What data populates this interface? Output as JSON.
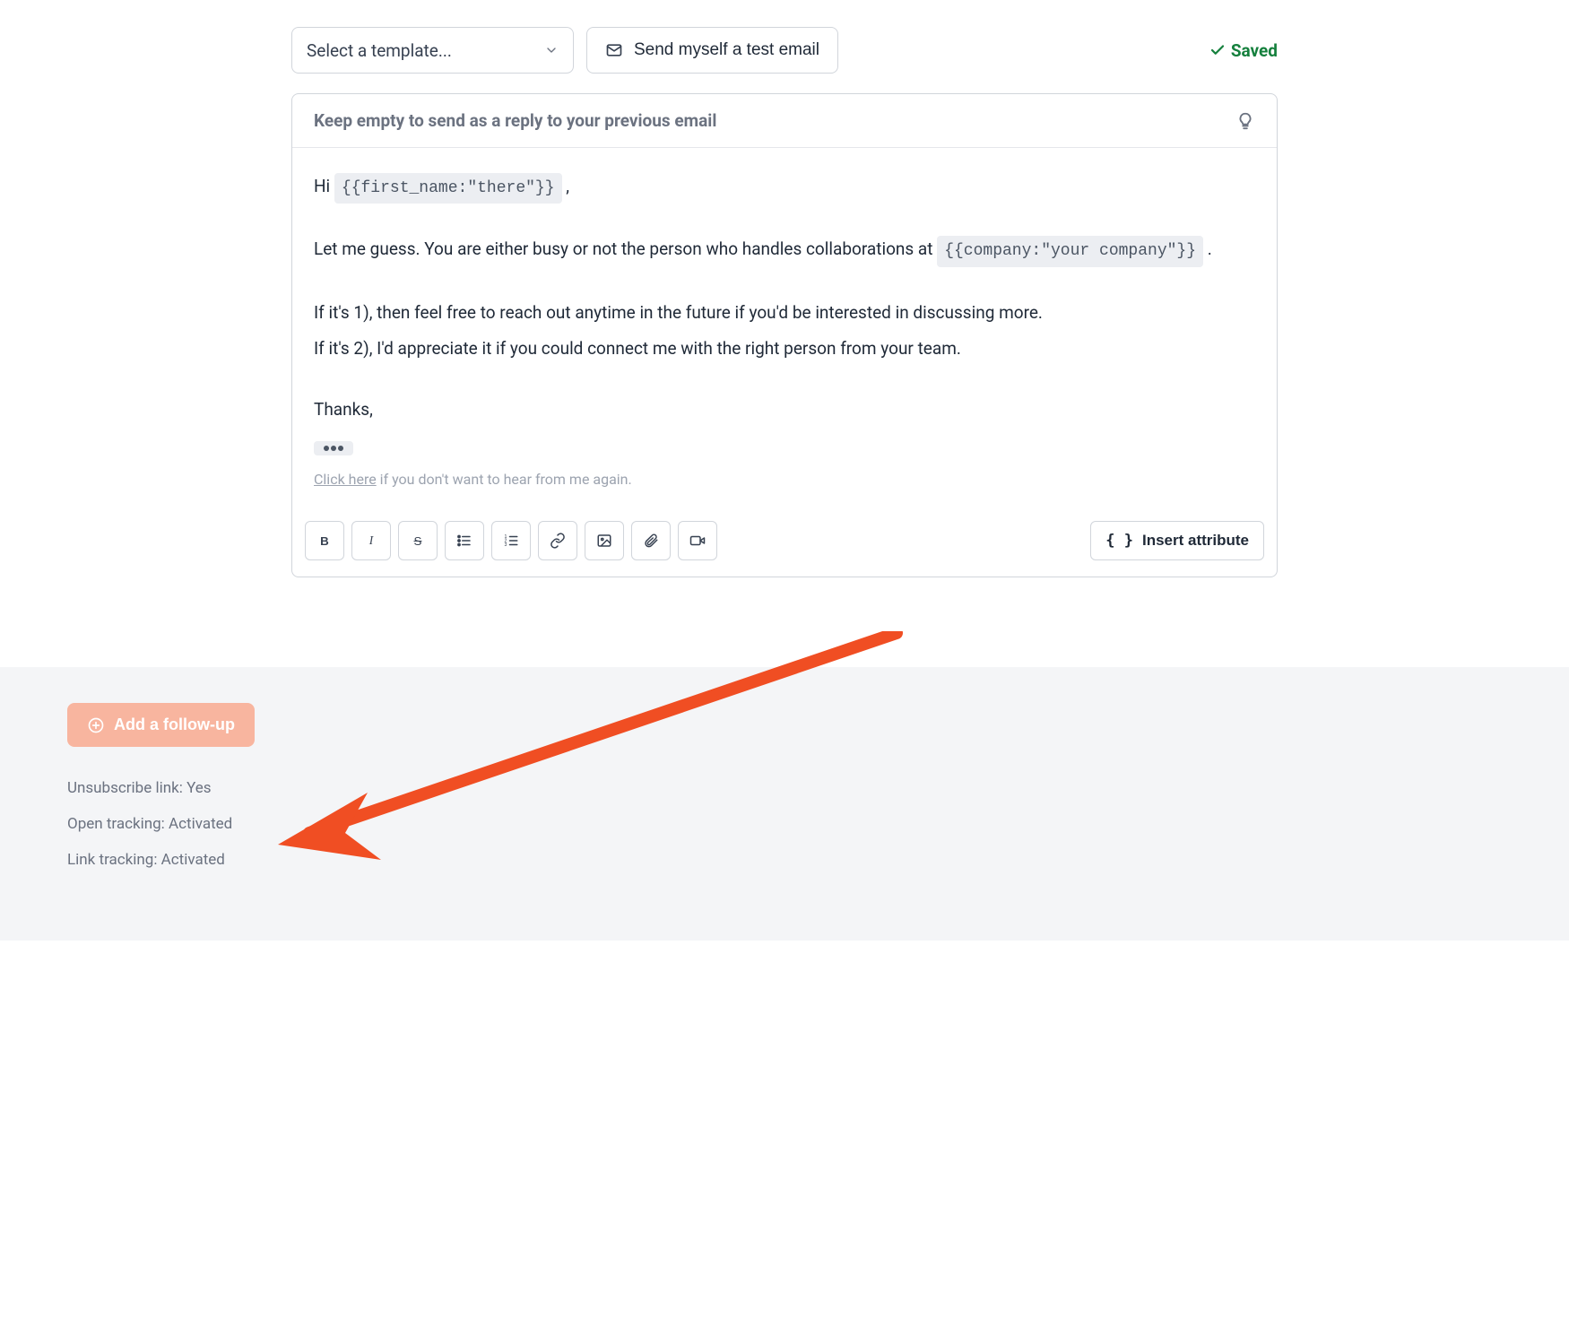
{
  "toolbar": {
    "select_template_placeholder": "Select a template...",
    "send_test_label": "Send myself a test email",
    "saved_label": "Saved"
  },
  "subject": {
    "placeholder": "Keep empty to send as a reply to your previous email"
  },
  "body": {
    "greeting_prefix": "Hi ",
    "greeting_tag": "{{first_name:\"there\"}}",
    "greeting_suffix": " ,",
    "p1_prefix": "Let me guess. You are either busy or not the person who handles collaborations at ",
    "p1_tag": "{{company:\"your company\"}}",
    "p1_suffix": " .",
    "p2": "If it's 1), then feel free to reach out anytime in the future if you'd be interested in discussing more.",
    "p3": "If it's 2), I'd appreciate it if you could connect me with the right person from your team.",
    "thanks": "Thanks,",
    "unsub_link": "Click here",
    "unsub_rest": " if you don't want to hear from me again."
  },
  "format_toolbar": {
    "insert_attribute_label": "Insert attribute"
  },
  "footer": {
    "add_followup_label": "Add a follow-up",
    "settings": [
      {
        "label": "Unsubscribe link:",
        "value": "Yes"
      },
      {
        "label": "Open tracking:",
        "value": "Activated"
      },
      {
        "label": "Link tracking:",
        "value": "Activated"
      }
    ]
  },
  "colors": {
    "accent_orange": "#f8b59f",
    "arrow_orange": "#f04e23",
    "saved_green": "#15803d"
  }
}
